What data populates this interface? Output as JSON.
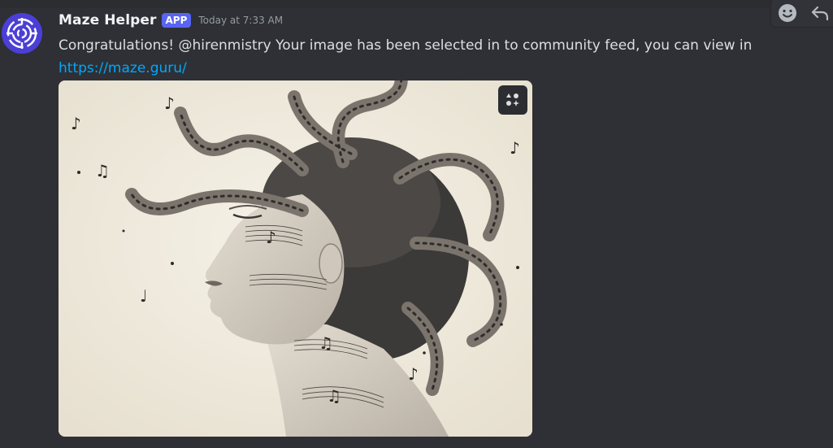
{
  "message": {
    "author": "Maze Helper",
    "badge": "APP",
    "timestamp": "Today at 7:33 AM",
    "text_before_link": "Congratulations! @hirenmistry Your image  has been selected in to community feed, you can view in ",
    "link_text": "https://maze.guru/",
    "link_href": "https://maze.guru/"
  },
  "image": {
    "alt": "Medusa with music notes"
  },
  "icons": {
    "avatar": "maze-logo-icon",
    "image_action": "apps-icon",
    "reaction": "emoji-smile-icon",
    "reply": "reply-arrow-icon"
  },
  "colors": {
    "background": "#2e3035",
    "badge": "#5865f2",
    "link": "#00a8fc",
    "avatar": "#4c3fd6"
  }
}
